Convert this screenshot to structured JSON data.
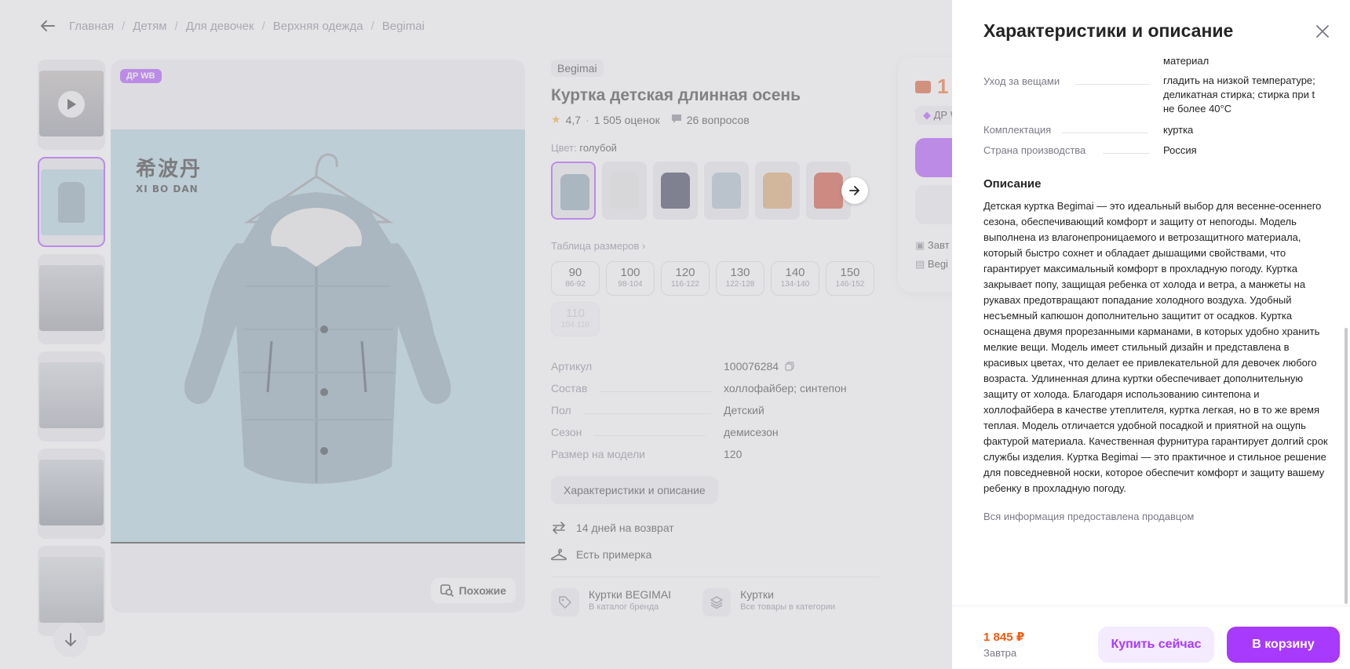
{
  "breadcrumb": [
    "Главная",
    "Детям",
    "Для девочек",
    "Верхняя одежда",
    "Begimai"
  ],
  "gallery": {
    "promo_badge": "ДР WB",
    "similar_label": "Похожие",
    "brand_mark_cn": "希波丹",
    "brand_mark_lat": "XI BO DAN"
  },
  "product": {
    "brand": "Begimai",
    "title": "Куртка детская длинная осень",
    "rating": "4,7",
    "reviews": "1 505 оценок",
    "questions": "26 вопросов",
    "color_label": "Цвет:",
    "color_value": "голубой",
    "size_table_link": "Таблица размеров",
    "sizes": [
      {
        "main": "90",
        "sub": "86-92"
      },
      {
        "main": "100",
        "sub": "98-104"
      },
      {
        "main": "120",
        "sub": "116-122"
      },
      {
        "main": "130",
        "sub": "122-128"
      },
      {
        "main": "140",
        "sub": "134-140"
      },
      {
        "main": "150",
        "sub": "146-152"
      },
      {
        "main": "110",
        "sub": "104-110"
      }
    ],
    "specs": [
      {
        "k": "Артикул",
        "v": "100076284"
      },
      {
        "k": "Состав",
        "v": "холлофайбер; синтепон"
      },
      {
        "k": "Пол",
        "v": "Детский"
      },
      {
        "k": "Сезон",
        "v": "демисезон"
      },
      {
        "k": "Размер на модели",
        "v": "120"
      }
    ],
    "chars_button": "Характеристики и описание",
    "return_label": "14 дней на возврат",
    "fitting_label": "Есть примерка",
    "brand_catalog_title": "Куртки BEGIMAI",
    "brand_catalog_sub": "В каталог бренда",
    "category_title": "Куртки",
    "category_sub": "Все товары в категории"
  },
  "price_card": {
    "price_partial": "1",
    "badge_partial": "ДР W",
    "line1": "Завт",
    "line2": "Begi"
  },
  "drawer": {
    "title": "Характеристики и описание",
    "rows": [
      {
        "k": "",
        "v": "материал"
      },
      {
        "k": "Уход за вещами",
        "v": "гладить на низкой температуре; деликатная стирка; стирка при t не более 40°C"
      },
      {
        "k": "Комплектация",
        "v": "куртка"
      },
      {
        "k": "Страна производства",
        "v": "Россия"
      }
    ],
    "desc_heading": "Описание",
    "desc_text": "Детская куртка Begimai — это идеальный выбор для весенне-осеннего сезона, обеспечивающий комфорт и защиту от непогоды. Модель выполнена из влагонепроницаемого и ветрозащитного материала, который быстро сохнет и обладает дышащими свойствами, что гарантирует максимальный комфорт в прохладную погоду. Куртка закрывает попу, защищая ребенка от холода и ветра, а манжеты на рукавах предотвращают попадание холодного воздуха. Удобный несъемный капюшон дополнительно защитит от осадков. Куртка оснащена двумя прорезанными карманами, в которых удобно хранить мелкие вещи. Модель имеет стильный дизайн и представлена в красивых цветах, что делает ее привлекательной для девочек любого возраста. Удлиненная длина куртки обеспечивает дополнительную защиту от холода. Благодаря использованию синтепона и холлофайбера в качестве утеплителя, куртка легкая, но в то же время теплая. Модель отличается удобной посадкой и приятной на ощупь фактурой материала. Качественная фурнитура гарантирует долгий срок службы изделия. Куртка Begimai — это практичное и стильное решение для повседневной носки, которое обеспечит комфорт и защиту вашему ребенку в прохладную погоду.",
    "seller_note": "Вся информация предоставлена продавцом",
    "footer_price": "1 845 ₽",
    "footer_date": "Завтра",
    "buy_now": "Купить сейчас",
    "to_cart": "В корзину"
  },
  "colors": {
    "accent": "#a73afd",
    "price": "#f25a0d",
    "swatches": [
      "#7f9aa8",
      "#e3e3e1",
      "#1f2540",
      "#a3b6c0",
      "#d79b5c",
      "#c9391f"
    ]
  }
}
